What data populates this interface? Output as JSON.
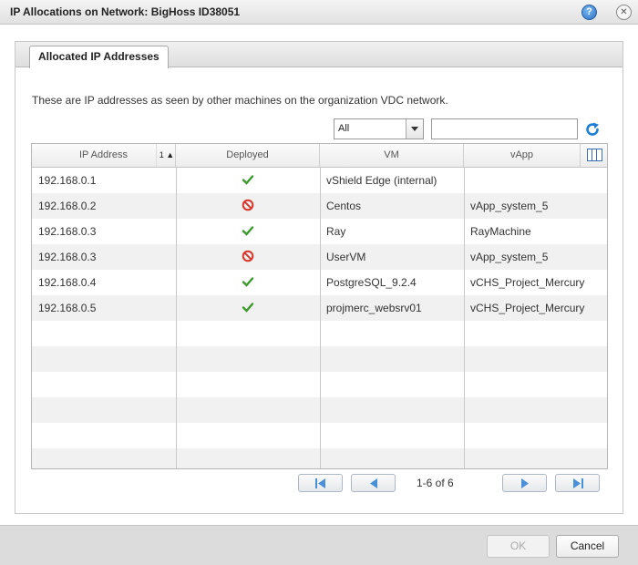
{
  "window": {
    "title": "IP Allocations on Network: BigHoss ID38051",
    "help_icon": "help-icon",
    "close_icon": "close-icon"
  },
  "tabs": [
    {
      "label": "Allocated IP Addresses",
      "active": true
    }
  ],
  "description": "These are IP addresses as seen by other machines on the organization VDC network.",
  "filter": {
    "selected": "All",
    "search_value": ""
  },
  "table": {
    "columns": [
      {
        "label": "IP Address",
        "sort": "1 ▲"
      },
      {
        "label": "Deployed"
      },
      {
        "label": "VM"
      },
      {
        "label": "vApp"
      }
    ],
    "rows": [
      {
        "ip": "192.168.0.1",
        "deployed": true,
        "vm": "vShield Edge (internal)",
        "vapp": ""
      },
      {
        "ip": "192.168.0.2",
        "deployed": false,
        "vm": "Centos",
        "vapp": "vApp_system_5"
      },
      {
        "ip": "192.168.0.3",
        "deployed": true,
        "vm": "Ray",
        "vapp": "RayMachine"
      },
      {
        "ip": "192.168.0.3",
        "deployed": false,
        "vm": "UserVM",
        "vapp": "vApp_system_5"
      },
      {
        "ip": "192.168.0.4",
        "deployed": true,
        "vm": "PostgreSQL_9.2.4",
        "vapp": "vCHS_Project_Mercury"
      },
      {
        "ip": "192.168.0.5",
        "deployed": true,
        "vm": "projmerc_websrv01",
        "vapp": "vCHS_Project_Mercury"
      }
    ],
    "empty_rows": 6
  },
  "pagination": {
    "info": "1-6 of 6"
  },
  "footer": {
    "ok_label": "OK",
    "ok_disabled": true,
    "cancel_label": "Cancel"
  },
  "colors": {
    "deployed_yes": "#3a9a2a",
    "deployed_no": "#d9362b",
    "accent": "#2a72c9"
  }
}
